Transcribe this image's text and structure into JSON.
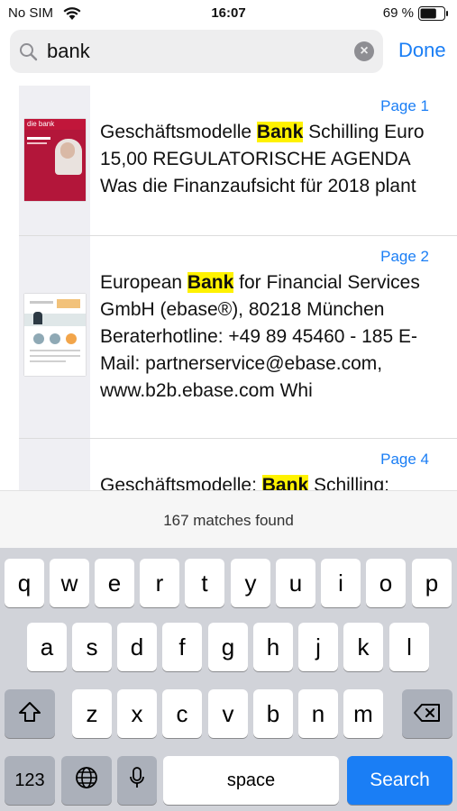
{
  "status_bar": {
    "carrier": "No SIM",
    "time": "16:07",
    "battery_percent": "69 %",
    "battery_level": 0.69
  },
  "search": {
    "query": "bank",
    "done_label": "Done"
  },
  "results": [
    {
      "page_label": "Page 1",
      "before": "Geschäftsmodelle ",
      "match": "Bank",
      "after": " Schilling Euro 15,00 REGULATORISCHE AGENDA Was die Finanzaufsicht für 2018 plant",
      "thumb_title": "die bank"
    },
    {
      "page_label": "Page 2",
      "before": "European ",
      "match": "Bank",
      "after": " for Financial Services GmbH (ebase®), 80218 München Beraterhotline: +49 89 45460 - 185 E-Mail: partnerservice@ebase.com, www.b2b.ebase.com Whi"
    },
    {
      "page_label": "Page 4",
      "before": "Geschäftsmodelle: ",
      "match": "Bank",
      "after": " Schilling:"
    }
  ],
  "matches_text": "167 matches found",
  "keyboard": {
    "row1": [
      "q",
      "w",
      "e",
      "r",
      "t",
      "y",
      "u",
      "i",
      "o",
      "p"
    ],
    "row2": [
      "a",
      "s",
      "d",
      "f",
      "g",
      "h",
      "j",
      "k",
      "l"
    ],
    "row3": [
      "z",
      "x",
      "c",
      "v",
      "b",
      "n",
      "m"
    ],
    "numbers_key": "123",
    "space_key": "space",
    "search_key": "Search"
  },
  "colors": {
    "accent": "#1a7ef5",
    "highlight": "#fff200",
    "keyboard_bg": "#d1d3d9"
  }
}
